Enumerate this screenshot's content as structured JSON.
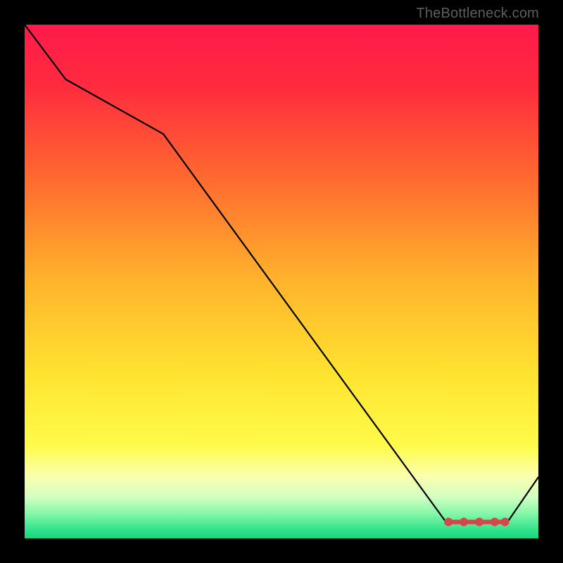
{
  "attribution": "TheBottleneck.com",
  "chart_data": {
    "type": "line",
    "x": [
      0.0,
      0.08,
      0.27,
      0.82,
      0.88,
      0.94,
      1.0
    ],
    "values": [
      100,
      89,
      78,
      0,
      0,
      0,
      9
    ],
    "marker_points_x": [
      0.825,
      0.855,
      0.885,
      0.915,
      0.935
    ],
    "marker_points_y": [
      0,
      0,
      0,
      0,
      0
    ],
    "title": "",
    "xlabel": "",
    "ylabel": "",
    "ylim": [
      0,
      100
    ],
    "xlim": [
      0,
      1
    ],
    "background_gradient_stops": [
      {
        "offset": 0.0,
        "color": "#ff1a4a"
      },
      {
        "offset": 0.12,
        "color": "#ff2b3f"
      },
      {
        "offset": 0.3,
        "color": "#ff6a2f"
      },
      {
        "offset": 0.5,
        "color": "#ffb42c"
      },
      {
        "offset": 0.68,
        "color": "#ffe330"
      },
      {
        "offset": 0.82,
        "color": "#fffb4a"
      },
      {
        "offset": 0.88,
        "color": "#faffb0"
      },
      {
        "offset": 0.92,
        "color": "#d1ffc1"
      },
      {
        "offset": 0.955,
        "color": "#7df5a6"
      },
      {
        "offset": 0.985,
        "color": "#2de28a"
      },
      {
        "offset": 1.0,
        "color": "#18d77e"
      }
    ],
    "marker_color": "#d04a4a",
    "line_color": "#000000"
  }
}
